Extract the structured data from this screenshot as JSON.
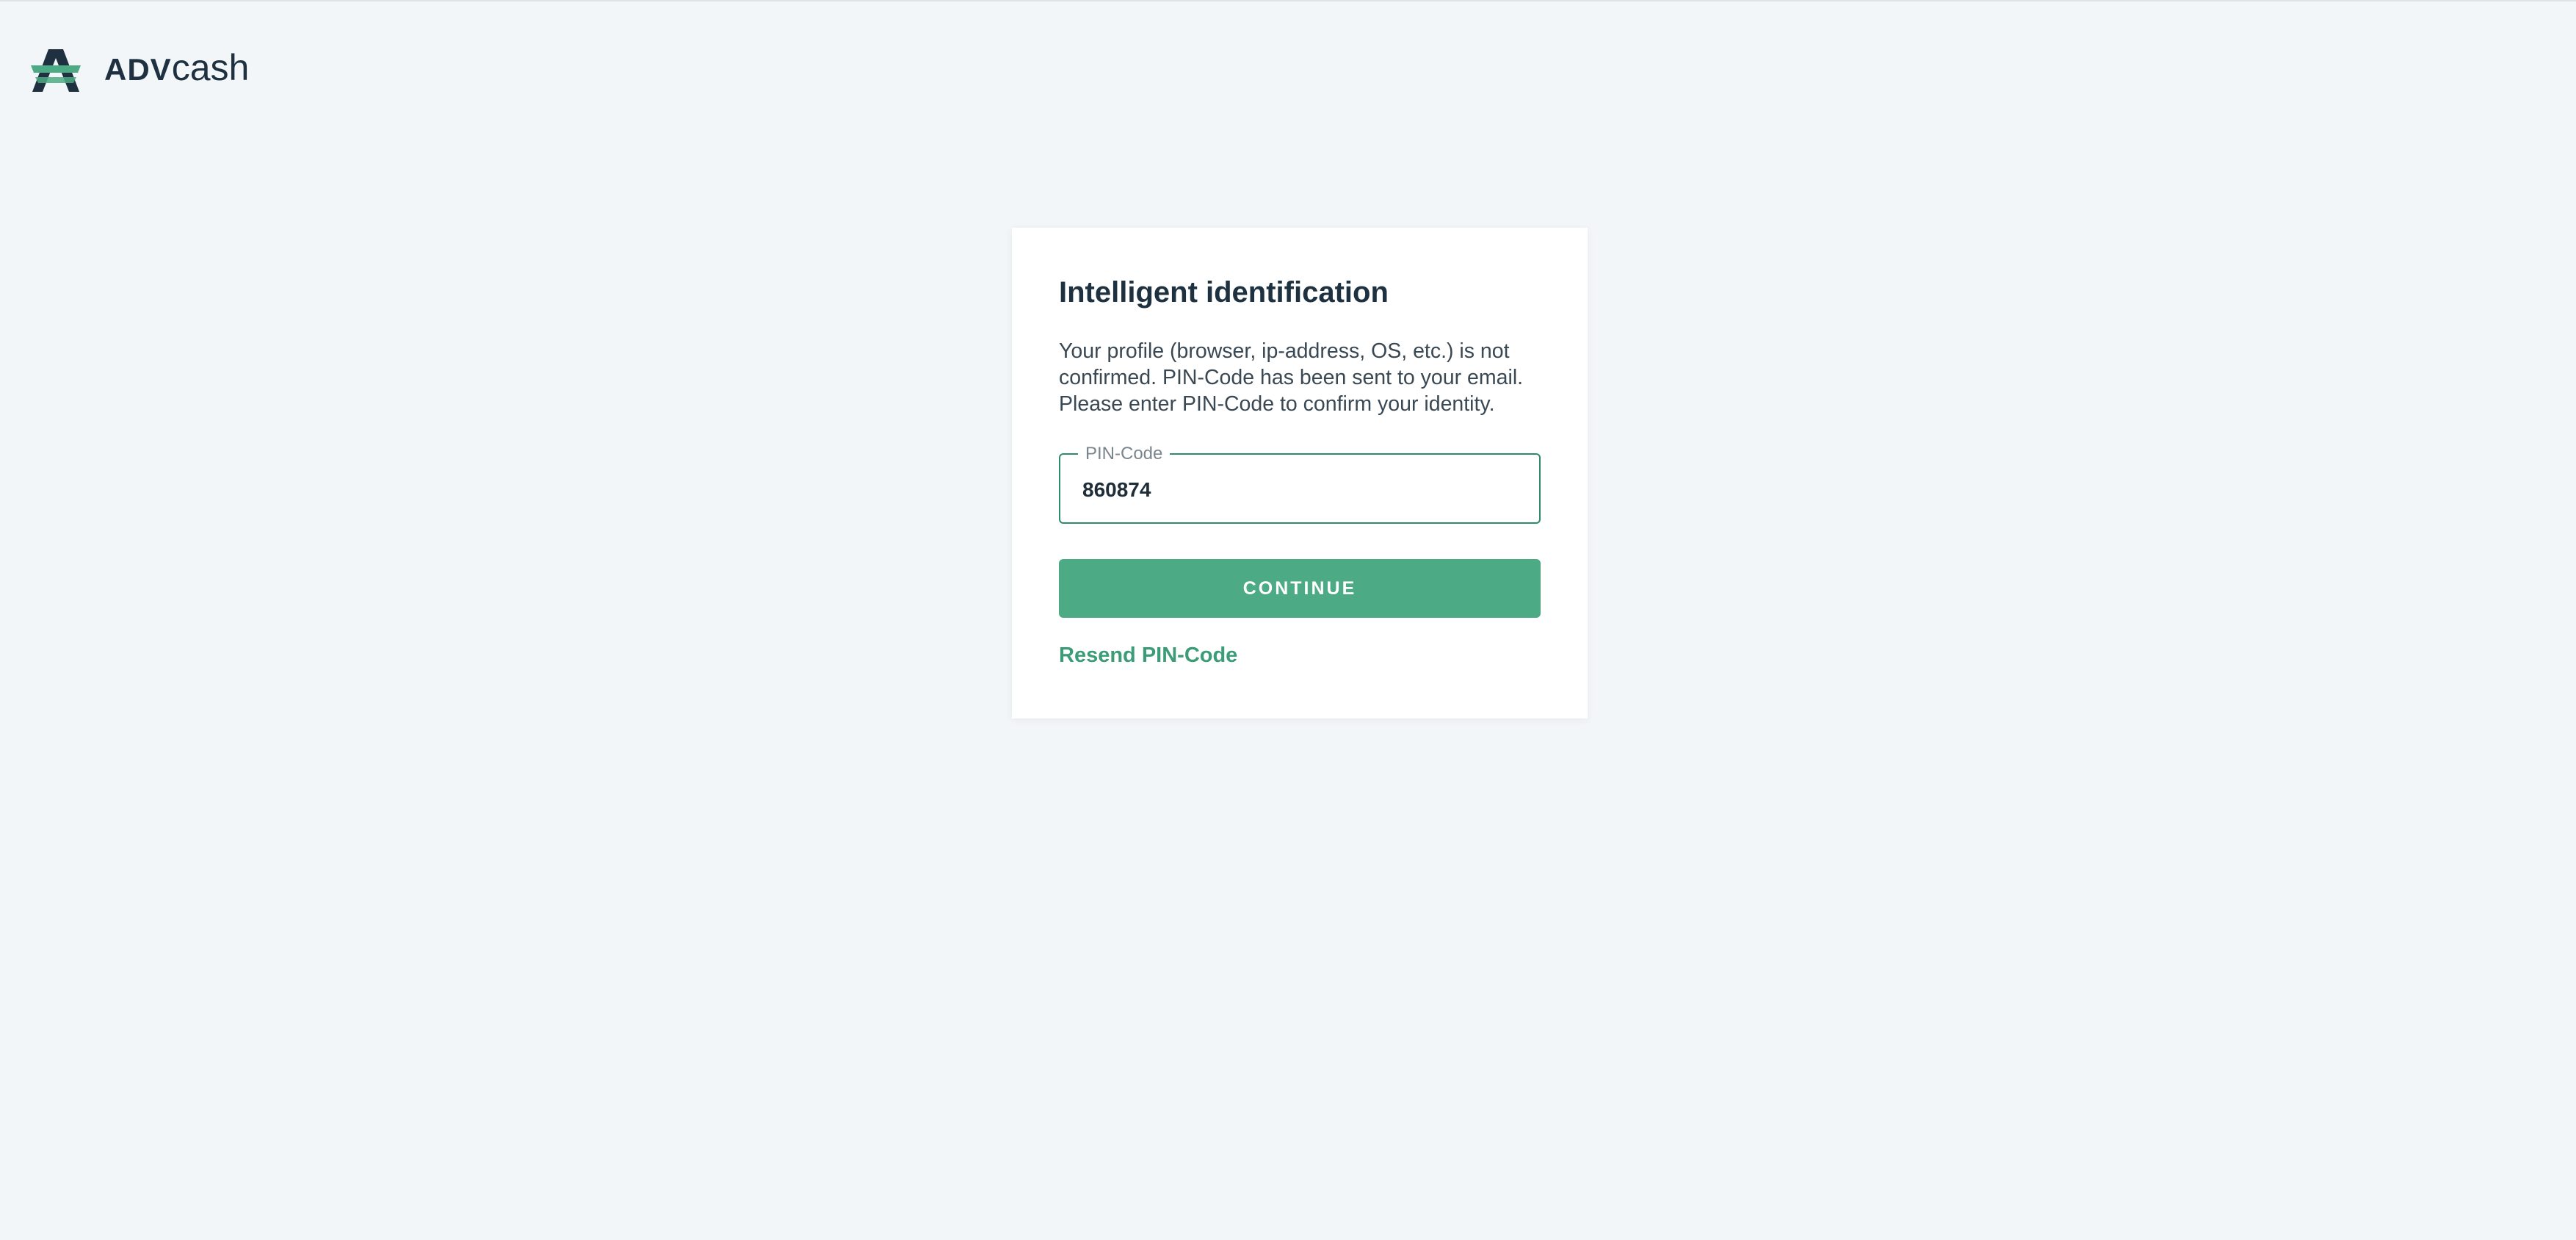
{
  "brand": {
    "logo_icon": "advcash-logo-icon",
    "name_bold": "ADV",
    "name_light": "cash",
    "colors": {
      "mark_dark": "#1f3140",
      "mark_green": "#4cab84"
    }
  },
  "card": {
    "title": "Intelligent identification",
    "description": "Your profile (browser, ip-address, OS, etc.) is not confirmed. PIN-Code has been sent to your email. Please enter PIN-Code to confirm your identity.",
    "pin_field": {
      "label": "PIN-Code",
      "value": "860874"
    },
    "continue_label": "CONTINUE",
    "resend_label": "Resend PIN-Code"
  },
  "colors": {
    "background": "#f2f6f9",
    "accent": "#4cab84",
    "field_border": "#2e8b6e",
    "link": "#3c9c78",
    "title_text": "#1e3140"
  }
}
